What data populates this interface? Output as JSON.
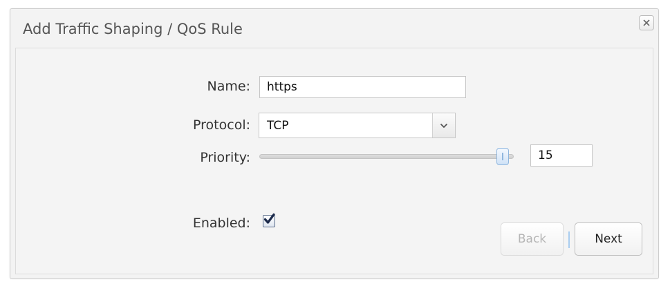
{
  "dialog": {
    "title": "Add Traffic Shaping / QoS Rule",
    "close_icon": "close-icon"
  },
  "form": {
    "name": {
      "label": "Name:",
      "value": "https"
    },
    "protocol": {
      "label": "Protocol:",
      "value": "TCP",
      "arrow_icon": "chevron-down-icon"
    },
    "priority": {
      "label": "Priority:",
      "value": "15",
      "slider_fraction": 0.98
    },
    "enabled": {
      "label": "Enabled:",
      "checked": true
    }
  },
  "buttons": {
    "back_label": "Back",
    "next_label": "Next"
  },
  "colors": {
    "panel_bg": "#f4f4f4",
    "title_text": "#555555",
    "slider_thumb": "#cfe2f6",
    "checkmark": "#1c2a4a"
  }
}
